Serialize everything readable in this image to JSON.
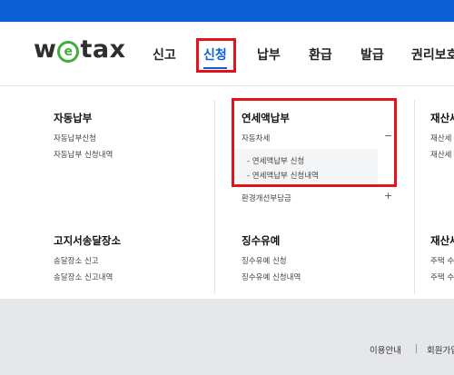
{
  "header": {
    "logo": {
      "w": "w",
      "e": "e",
      "rest": "tax"
    },
    "nav": [
      "신고",
      "신청",
      "납부",
      "환급",
      "발급",
      "권리보호"
    ]
  },
  "menu": {
    "col1": {
      "title1": "자동납부",
      "items1": [
        "자동납부신청",
        "자동납부 신청내역"
      ],
      "title2": "고지서송달장소",
      "items2": [
        "송달장소 신고",
        "송달장소 신고내역"
      ]
    },
    "col2": {
      "title1": "연세액납부",
      "car": {
        "label": "자동차세",
        "toggle": "−"
      },
      "subs": [
        "- 연세액납부 신청",
        "- 연세액납부 신청내역"
      ],
      "env": {
        "label": "환경개선부담금",
        "toggle": "+"
      },
      "title2": "징수유예",
      "items2": [
        "징수유예 신청",
        "징수유예 신청내역"
      ]
    },
    "col3": {
      "title1": "재산세",
      "items1": [
        "재산세",
        "재산세"
      ],
      "title2": "재산세",
      "items2": [
        "주택 수",
        "주택 수"
      ]
    }
  },
  "footer": {
    "links": [
      "이용안내",
      "회원가입"
    ]
  }
}
